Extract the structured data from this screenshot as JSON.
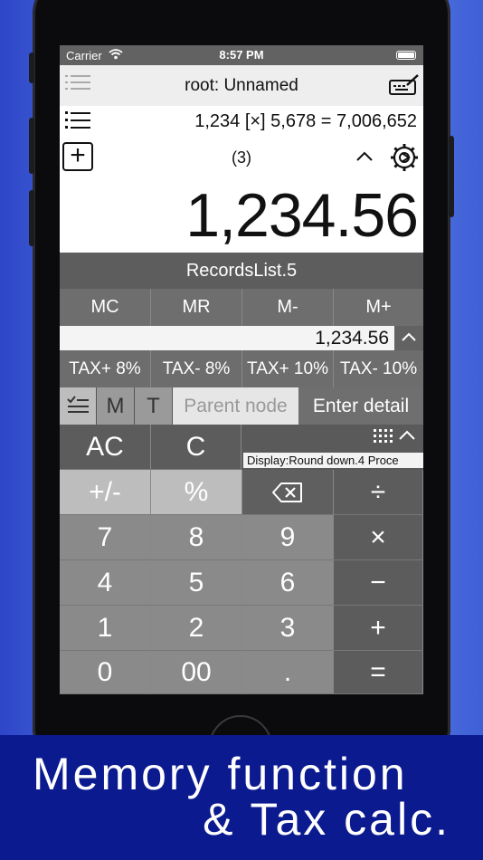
{
  "status": {
    "carrier": "Carrier",
    "time": "8:57 PM"
  },
  "navbar": {
    "title": "root: Unnamed"
  },
  "display": {
    "formula": "1,234 [×] 5,678 = 7,006,652",
    "count": "(3)",
    "main_value": "1,234.56",
    "caret": "^"
  },
  "records_label": "RecordsList.5",
  "memory": {
    "buttons": [
      "MC",
      "MR",
      "M-",
      "M+"
    ],
    "value": "1,234.56"
  },
  "tax": {
    "buttons": [
      "TAX+ 8%",
      "TAX- 8%",
      "TAX+ 10%",
      "TAX- 10%"
    ]
  },
  "detail": {
    "m_label": "M",
    "t_label": "T",
    "parent_node_placeholder": "Parent node",
    "enter_detail": "Enter detail"
  },
  "status_strip": {
    "text": "Display:Round down.4 Proce"
  },
  "keys": {
    "ac": "AC",
    "c": "C",
    "plusminus": "+/-",
    "percent": "%",
    "divide": "÷",
    "seven": "7",
    "eight": "8",
    "nine": "9",
    "multiply": "×",
    "four": "4",
    "five": "5",
    "six": "6",
    "minus": "−",
    "one": "1",
    "two": "2",
    "three": "3",
    "plus": "+",
    "zero": "0",
    "double_zero": "00",
    "dot": ".",
    "equals": "="
  },
  "caption": {
    "line1": "Memory function",
    "line2": "& Tax calc."
  },
  "colors": {
    "background": "#4f6fe0",
    "caption_bg": "#0b1a8f",
    "display_bg": "#ffffff",
    "key_dark": "#5c5c5c",
    "key_num": "#8a8a8a"
  }
}
